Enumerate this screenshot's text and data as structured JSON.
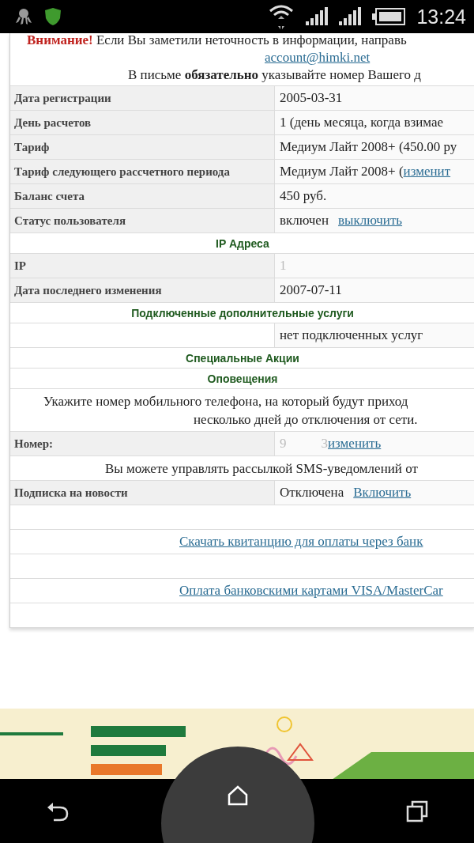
{
  "status_bar": {
    "time": "13:24"
  },
  "notice": {
    "warning": "Внимание!",
    "text": "Если Вы заметили неточность в информации, направь",
    "email": "account@himki.net",
    "note": "В письме **обязательно** указывайте номер Вашего д"
  },
  "rows": [
    {
      "kind": "field",
      "label": "Дата регистрации",
      "value": "2005-03-31",
      "faded": false
    },
    {
      "kind": "field",
      "label": "День расчетов",
      "value": "1 (день месяца, когда взимае",
      "faded": false
    },
    {
      "kind": "field",
      "label": "Тариф",
      "value": "Медиум Лайт 2008+ (450.00 ру",
      "faded": false
    },
    {
      "kind": "field",
      "label": "Тариф следующего рассчетного периода",
      "value": "Медиум Лайт 2008+ (",
      "link": "изменит",
      "faded": false
    },
    {
      "kind": "field",
      "label": "Баланс счета",
      "value": "450 руб.",
      "faded": false
    },
    {
      "kind": "field",
      "label": "Статус пользователя",
      "value": "включен",
      "link": "выключить",
      "faded": false
    },
    {
      "kind": "section",
      "title": "IP Адреса"
    },
    {
      "kind": "field",
      "label": "IP",
      "value": "1",
      "faded": true
    },
    {
      "kind": "field",
      "label": "Дата последнего изменения",
      "value": "2007-07-11",
      "faded": false
    },
    {
      "kind": "section",
      "title": "Подключенные дополнительные услуги"
    },
    {
      "kind": "field",
      "value": "нет подключенных услуг",
      "faded": false
    },
    {
      "kind": "section",
      "title": "Специальные Акции"
    },
    {
      "kind": "section",
      "title": "Оповещения"
    },
    {
      "kind": "text",
      "lines": [
        "Укажите номер мобильного телефона, на который будут приход",
        "несколько дней до отключения от сети."
      ]
    },
    {
      "kind": "field",
      "label": "Номер:",
      "value": "9",
      "value_end": "3",
      "link": "изменить",
      "faded": true
    },
    {
      "kind": "text",
      "lines": [
        "Вы можете управлять рассылкой SMS-уведомлений от"
      ]
    },
    {
      "kind": "field",
      "label": "Подписка на новости",
      "value": "Отключена",
      "link": "Включить",
      "faded": false
    },
    {
      "kind": "empty"
    },
    {
      "kind": "link",
      "link": "Скачать квитанцию для оплаты через банк"
    },
    {
      "kind": "empty"
    },
    {
      "kind": "link",
      "link": "Оплата банковскими картами VISA/MasterCar"
    },
    {
      "kind": "empty"
    }
  ]
}
